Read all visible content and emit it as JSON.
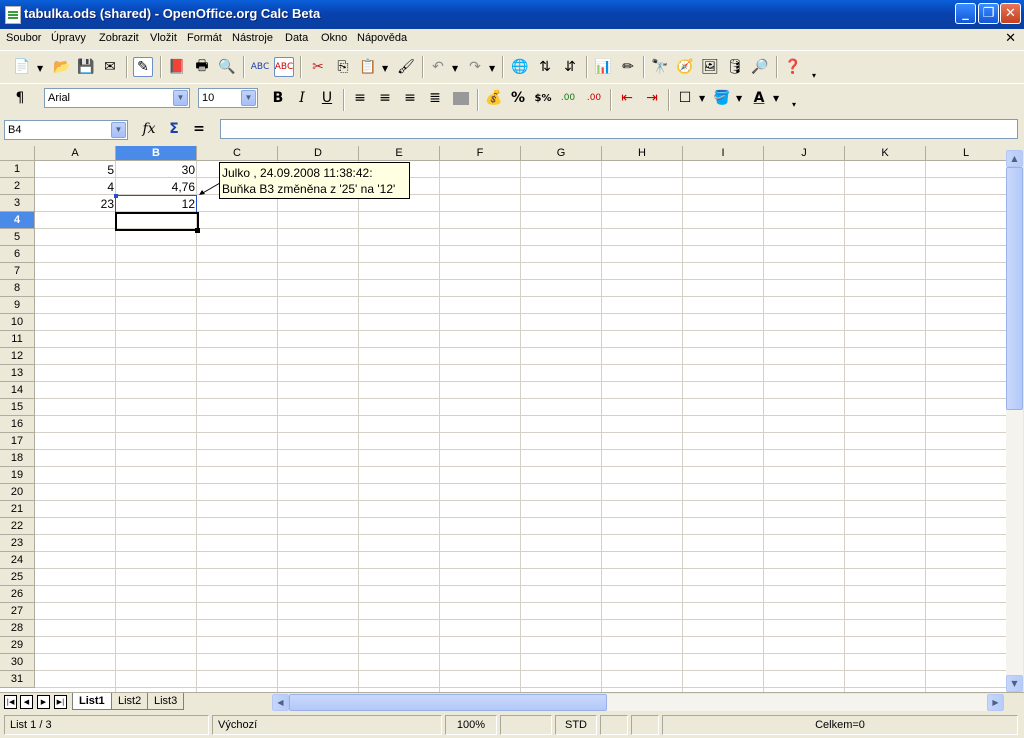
{
  "window": {
    "title": "tabulka.ods (shared) - OpenOffice.org Calc Beta"
  },
  "menu": {
    "items": [
      "Soubor",
      "Úpravy",
      "Zobrazit",
      "Vložit",
      "Formát",
      "Nástroje",
      "Data",
      "Okno",
      "Nápověda"
    ]
  },
  "format_bar": {
    "font_name": "Arial",
    "font_size": "10"
  },
  "formula_bar": {
    "name_box": "B4",
    "formula": ""
  },
  "grid": {
    "columns": [
      "A",
      "B",
      "C",
      "D",
      "E",
      "F",
      "G",
      "H",
      "I",
      "J",
      "K",
      "L"
    ],
    "rows": [
      "1",
      "2",
      "3",
      "4",
      "5",
      "6",
      "7",
      "8",
      "9",
      "10",
      "11",
      "12",
      "13",
      "14",
      "15",
      "16",
      "17",
      "18",
      "19",
      "20",
      "21",
      "22",
      "23",
      "24",
      "25",
      "26",
      "27",
      "28",
      "29",
      "30",
      "31"
    ],
    "cells": {
      "A1": "5",
      "B1": "30",
      "A2": "4",
      "B2": "4,76",
      "A3": "23",
      "B3": "12"
    },
    "selected_cell": "B4"
  },
  "change_tooltip": {
    "line1": "Julko , 24.09.2008 11:38:42:",
    "line2": "Buňka B3 změněna z '25' na '12'"
  },
  "sheets": {
    "tabs": [
      "List1",
      "List2",
      "List3"
    ],
    "active": "List1"
  },
  "status": {
    "sheet": "List 1 / 3",
    "page_style": "Výchozí",
    "zoom": "100%",
    "mode": "STD",
    "sum": "Celkem=0"
  }
}
